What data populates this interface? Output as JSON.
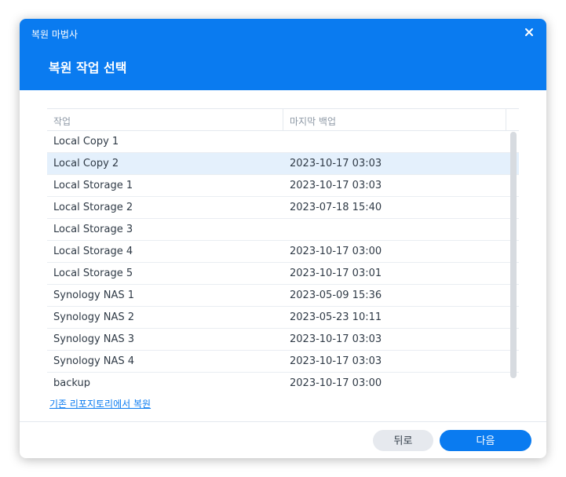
{
  "dialog": {
    "window_title": "복원 마법사",
    "step_title": "복원 작업 선택",
    "close_icon": "close-icon"
  },
  "table": {
    "columns": [
      "작업",
      "마지막 백업"
    ],
    "rows": [
      {
        "job": "Local Copy 1",
        "last_backup": ""
      },
      {
        "job": "Local Copy 2",
        "last_backup": "2023-10-17 03:03",
        "selected": true
      },
      {
        "job": "Local Storage 1",
        "last_backup": "2023-10-17 03:03"
      },
      {
        "job": "Local Storage 2",
        "last_backup": "2023-07-18 15:40"
      },
      {
        "job": "Local Storage 3",
        "last_backup": ""
      },
      {
        "job": "Local Storage 4",
        "last_backup": "2023-10-17 03:00"
      },
      {
        "job": "Local Storage 5",
        "last_backup": "2023-10-17 03:01"
      },
      {
        "job": "Synology NAS 1",
        "last_backup": "2023-05-09 15:36"
      },
      {
        "job": "Synology NAS 2",
        "last_backup": "2023-05-23 10:11"
      },
      {
        "job": "Synology NAS 3",
        "last_backup": "2023-10-17 03:03"
      },
      {
        "job": "Synology NAS 4",
        "last_backup": "2023-10-17 03:03"
      },
      {
        "job": "backup",
        "last_backup": "2023-10-17 03:00"
      }
    ]
  },
  "restore_link": "기존 리포지토리에서 복원",
  "buttons": {
    "back": "뒤로",
    "next": "다음"
  },
  "colors": {
    "accent": "#0a7bf0",
    "selected_row": "#e4f0fc"
  }
}
